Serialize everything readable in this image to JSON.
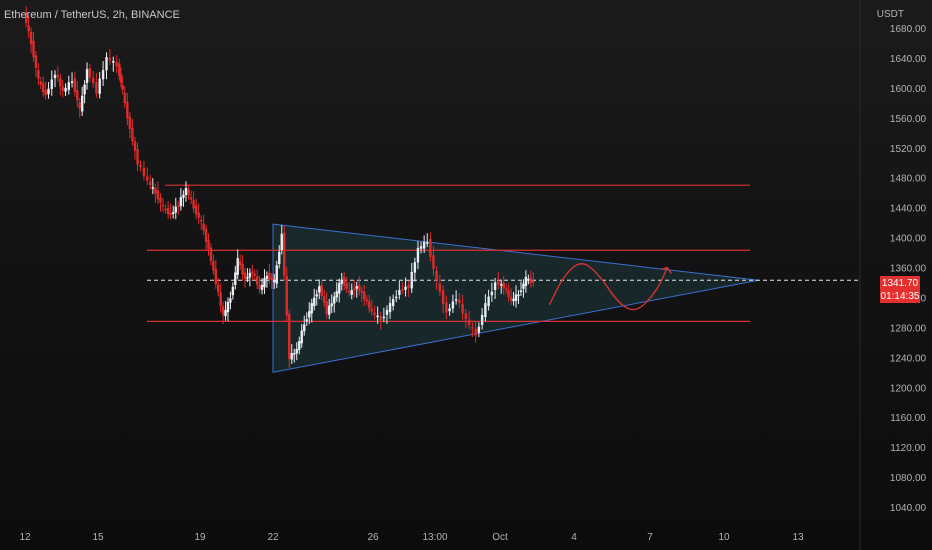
{
  "header": {
    "title": "Ethereum / TetherUS, 2h, BINANCE",
    "currency": "USDT"
  },
  "price_badge": {
    "price": "1341.70",
    "countdown": "01:14:35",
    "color": "#e4302f"
  },
  "colors": {
    "candle_up": "#e8eef5",
    "candle_down": "#e02b2b",
    "level_line": "#d43232",
    "triangle_border": "#3b6fd0",
    "triangle_fill": "#1d3a3e"
  },
  "chart_data": {
    "type": "candlestick",
    "title": "Ethereum / TetherUS, 2h, BINANCE",
    "ylabel": "USDT",
    "ylim": [
      1020,
      1700
    ],
    "y_ticks": [
      "1680.00",
      "1640.00",
      "1600.00",
      "1560.00",
      "1520.00",
      "1480.00",
      "1440.00",
      "1400.00",
      "1360.00",
      "1320.00",
      "1280.00",
      "1240.00",
      "1200.00",
      "1160.00",
      "1120.00",
      "1080.00",
      "1040.00"
    ],
    "x_ticks": [
      "12",
      "15",
      "19",
      "22",
      "26",
      "13:00",
      "Oct",
      "4",
      "7",
      "10",
      "13"
    ],
    "price_path": [
      [
        12.0,
        1700
      ],
      [
        12.3,
        1660
      ],
      [
        12.6,
        1610
      ],
      [
        12.9,
        1590
      ],
      [
        13.3,
        1620
      ],
      [
        13.6,
        1595
      ],
      [
        14.0,
        1610
      ],
      [
        14.3,
        1570
      ],
      [
        14.6,
        1625
      ],
      [
        15.0,
        1595
      ],
      [
        15.4,
        1640
      ],
      [
        15.8,
        1630
      ],
      [
        16.0,
        1595
      ],
      [
        16.3,
        1545
      ],
      [
        16.6,
        1500
      ],
      [
        17.0,
        1475
      ],
      [
        17.3,
        1460
      ],
      [
        17.6,
        1440
      ],
      [
        17.9,
        1430
      ],
      [
        18.2,
        1445
      ],
      [
        18.5,
        1465
      ],
      [
        18.8,
        1440
      ],
      [
        19.1,
        1420
      ],
      [
        19.4,
        1385
      ],
      [
        19.7,
        1340
      ],
      [
        20.0,
        1295
      ],
      [
        20.3,
        1320
      ],
      [
        20.6,
        1370
      ],
      [
        20.9,
        1345
      ],
      [
        21.2,
        1355
      ],
      [
        21.5,
        1330
      ],
      [
        21.8,
        1350
      ],
      [
        22.1,
        1340
      ],
      [
        22.4,
        1405
      ],
      [
        22.7,
        1240
      ],
      [
        23.0,
        1250
      ],
      [
        23.3,
        1285
      ],
      [
        23.6,
        1310
      ],
      [
        23.9,
        1335
      ],
      [
        24.2,
        1300
      ],
      [
        24.5,
        1320
      ],
      [
        24.8,
        1345
      ],
      [
        25.1,
        1325
      ],
      [
        25.4,
        1335
      ],
      [
        25.7,
        1320
      ],
      [
        26.0,
        1300
      ],
      [
        26.3,
        1290
      ],
      [
        26.6,
        1310
      ],
      [
        26.9,
        1330
      ],
      [
        27.2,
        1335
      ],
      [
        27.5,
        1385
      ],
      [
        27.8,
        1395
      ],
      [
        28.1,
        1340
      ],
      [
        28.4,
        1300
      ],
      [
        28.7,
        1320
      ],
      [
        29.0,
        1290
      ],
      [
        29.3,
        1270
      ],
      [
        29.6,
        1310
      ],
      [
        29.9,
        1340
      ],
      [
        30.2,
        1335
      ],
      [
        30.5,
        1315
      ],
      [
        30.8,
        1325
      ],
      [
        31.1,
        1345
      ],
      [
        31.4,
        1340
      ]
    ],
    "levels": [
      1470,
      1383,
      1343,
      1288
    ],
    "triangle": {
      "upper": [
        [
          22.0,
          1418
        ],
        [
          40.4,
          1343
        ]
      ],
      "lower": [
        [
          22.0,
          1220
        ],
        [
          40.4,
          1343
        ]
      ]
    },
    "projection_arrow": [
      [
        32.0,
        1310
      ],
      [
        32.6,
        1350
      ],
      [
        33.3,
        1370
      ],
      [
        34.0,
        1350
      ],
      [
        34.8,
        1310
      ],
      [
        35.5,
        1300
      ],
      [
        36.3,
        1330
      ],
      [
        36.7,
        1360
      ]
    ]
  }
}
